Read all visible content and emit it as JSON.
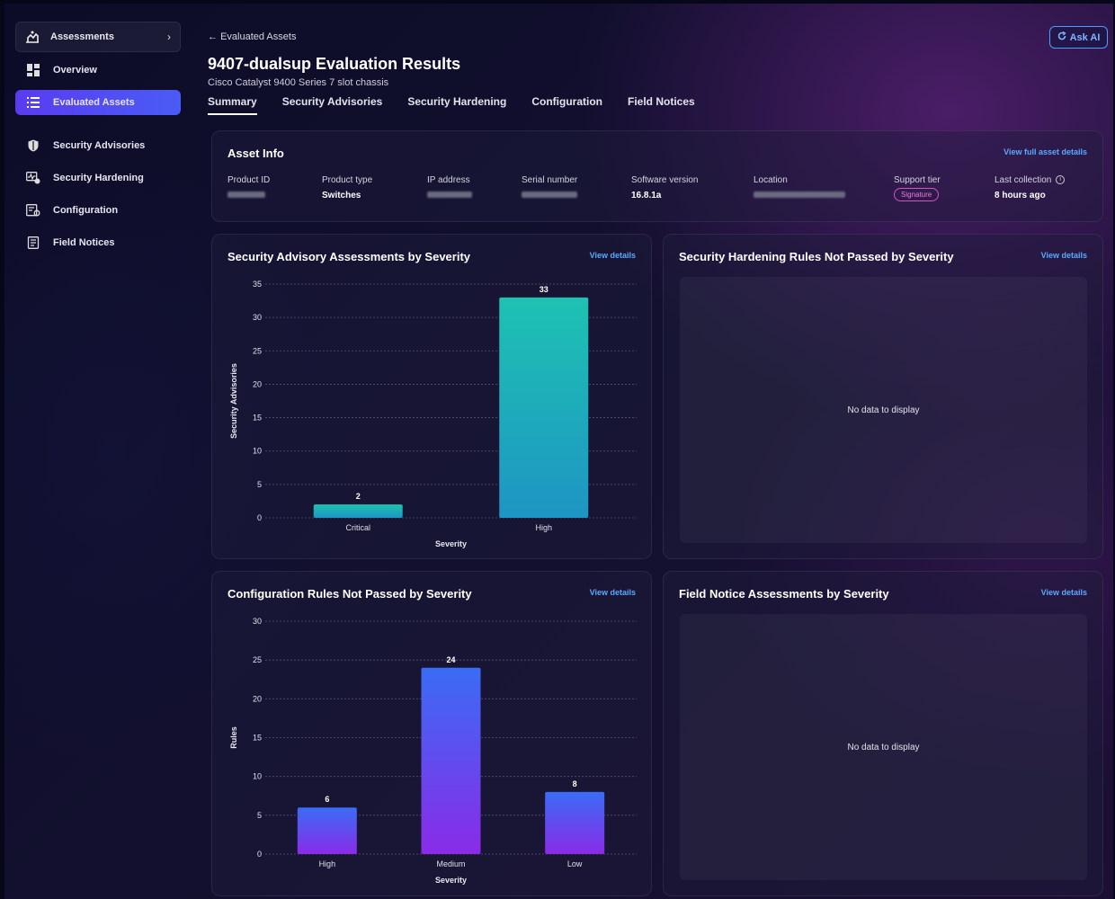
{
  "sidebar": {
    "header": "Assessments",
    "items": [
      {
        "label": "Overview"
      },
      {
        "label": "Evaluated Assets"
      },
      {
        "label": "Security Advisories"
      },
      {
        "label": "Security Hardening"
      },
      {
        "label": "Configuration"
      },
      {
        "label": "Field Notices"
      }
    ]
  },
  "header": {
    "back_label": "Evaluated Assets",
    "title": "9407-dualsup Evaluation Results",
    "subtitle": "Cisco Catalyst 9400 Series 7 slot chassis",
    "ask_ai": "Ask AI"
  },
  "tabs": [
    "Summary",
    "Security Advisories",
    "Security Hardening",
    "Configuration",
    "Field Notices"
  ],
  "asset_info": {
    "title": "Asset Info",
    "link": "View full asset details",
    "fields": {
      "product_id": {
        "label": "Product ID"
      },
      "product_type": {
        "label": "Product type",
        "value": "Switches"
      },
      "ip_address": {
        "label": "IP address"
      },
      "serial_number": {
        "label": "Serial number"
      },
      "software_version": {
        "label": "Software version",
        "value": "16.8.1a"
      },
      "location": {
        "label": "Location"
      },
      "support_tier": {
        "label": "Support tier",
        "value": "Signature"
      },
      "last_collection": {
        "label": "Last collection",
        "value": "8 hours ago"
      }
    }
  },
  "panels": {
    "advisory": {
      "title": "Security Advisory Assessments by Severity",
      "link": "View details"
    },
    "hardening": {
      "title": "Security Hardening Rules Not Passed by Severity",
      "link": "View details",
      "empty": "No data to display"
    },
    "config": {
      "title": "Configuration Rules Not Passed by Severity",
      "link": "View details"
    },
    "field_notice": {
      "title": "Field Notice Assessments by Severity",
      "link": "View details",
      "empty": "No data to display"
    }
  },
  "chart_data": [
    {
      "type": "bar",
      "title": "Security Advisory Assessments by Severity",
      "categories": [
        "Critical",
        "High"
      ],
      "values": [
        2,
        33
      ],
      "xlabel": "Severity",
      "ylabel": "Security Advisories",
      "ylim": [
        0,
        35
      ],
      "yticks": [
        0,
        5,
        10,
        15,
        20,
        25,
        30,
        35
      ],
      "grid": true,
      "colors": [
        "#1ec2b2",
        "#1e95c4"
      ]
    },
    {
      "type": "bar",
      "title": "Configuration Rules Not Passed by Severity",
      "categories": [
        "High",
        "Medium",
        "Low"
      ],
      "values": [
        6,
        24,
        8
      ],
      "xlabel": "Severity",
      "ylabel": "Rules",
      "ylim": [
        0,
        30
      ],
      "yticks": [
        0,
        5,
        10,
        15,
        20,
        25,
        30
      ],
      "grid": true,
      "colors": [
        "#3a6cf5",
        "#8a2be8"
      ]
    }
  ]
}
